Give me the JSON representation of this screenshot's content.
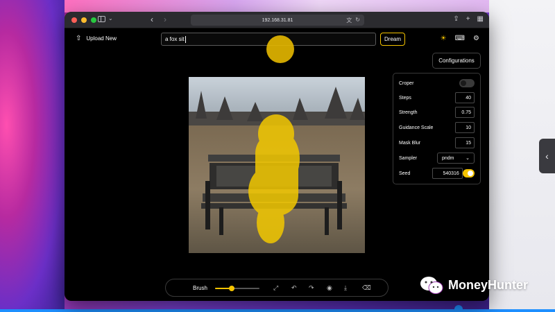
{
  "browser": {
    "url": "192.168.31.81"
  },
  "app": {
    "upload_label": "Upload New",
    "prompt_value": "a fox sit",
    "dream_label": "Dream",
    "configurations_label": "Configurations"
  },
  "config": {
    "croper_label": "Croper",
    "croper_enabled": false,
    "steps_label": "Steps",
    "steps_value": "40",
    "strength_label": "Strength",
    "strength_value": "0.75",
    "guidance_label": "Guidance Scale",
    "guidance_value": "10",
    "maskblur_label": "Mask Blur",
    "maskblur_value": "15",
    "sampler_label": "Sampler",
    "sampler_value": "pndm",
    "seed_label": "Seed",
    "seed_value": "540316",
    "seed_enabled": true
  },
  "toolbar": {
    "brush_label": "Brush",
    "brush_size_fraction": 0.38
  },
  "colors": {
    "accent": "#f5c400",
    "mask": "#f2c800"
  },
  "watermark": {
    "text": "MoneyHunter"
  }
}
